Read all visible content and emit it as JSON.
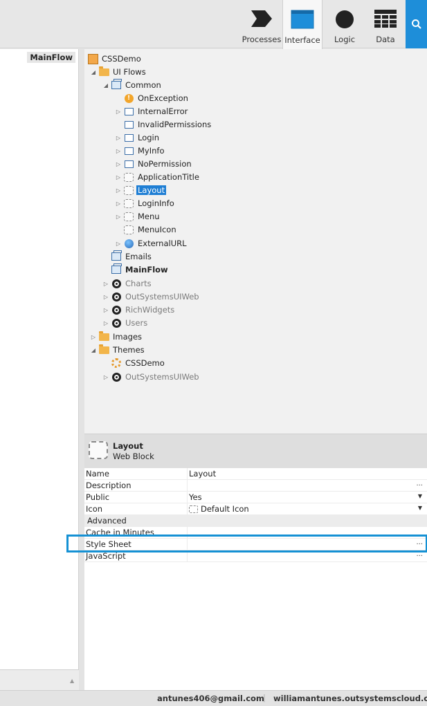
{
  "toolbar": {
    "processes": "Processes",
    "interface": "Interface",
    "logic": "Logic",
    "data": "Data"
  },
  "left": {
    "tab": "MainFlow"
  },
  "tree": {
    "root": "CSSDemo",
    "ui_flows": "UI Flows",
    "common": "Common",
    "on_exception": "OnException",
    "internal_error": "InternalError",
    "invalid_permissions": "InvalidPermissions",
    "login": "Login",
    "my_info": "MyInfo",
    "no_permission": "NoPermission",
    "application_title": "ApplicationTitle",
    "layout": "Layout",
    "login_info": "LoginInfo",
    "menu": "Menu",
    "menu_icon": "MenuIcon",
    "external_url": "ExternalURL",
    "emails": "Emails",
    "main_flow": "MainFlow",
    "charts": "Charts",
    "outsystems_ui_web": "OutSystemsUIWeb",
    "rich_widgets": "RichWidgets",
    "users": "Users",
    "images": "Images",
    "themes": "Themes",
    "theme_cssdemo": "CSSDemo",
    "theme_outsystems": "OutSystemsUIWeb"
  },
  "properties": {
    "name": "Layout",
    "type": "Web Block",
    "rows": {
      "name_k": "Name",
      "name_v": "Layout",
      "desc_k": "Description",
      "public_k": "Public",
      "public_v": "Yes",
      "icon_k": "Icon",
      "icon_v": "Default Icon",
      "advanced": "Advanced",
      "cache_k": "Cache in Minutes",
      "style_k": "Style Sheet",
      "js_k": "JavaScript"
    },
    "dots": "..."
  },
  "status": {
    "email": "antunes406@gmail.com",
    "divider": "|",
    "server": "williamantunes.outsystemscloud.com"
  }
}
